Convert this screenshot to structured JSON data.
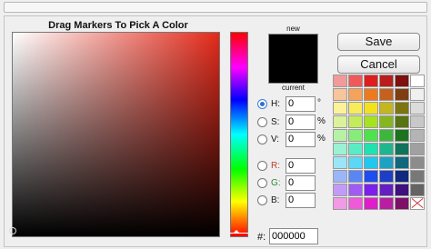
{
  "picker": {
    "title": "Drag Markers To Pick A Color",
    "new_label": "new",
    "current_label": "current",
    "new_color": "#000000",
    "current_color": "#000000"
  },
  "buttons": {
    "save": "Save",
    "cancel": "Cancel"
  },
  "fields": {
    "h": {
      "label": "H:",
      "value": "0",
      "unit": "°",
      "selected": true
    },
    "s": {
      "label": "S:",
      "value": "0",
      "unit": "%",
      "selected": false
    },
    "v": {
      "label": "V:",
      "value": "0",
      "unit": "%",
      "selected": false
    },
    "r": {
      "label": "R:",
      "value": "0",
      "selected": false,
      "color": "#c0392b"
    },
    "g": {
      "label": "G:",
      "value": "0",
      "selected": false,
      "color": "#2e8b2e"
    },
    "b": {
      "label": "B:",
      "value": "0",
      "selected": false,
      "color": "#1a1a1a"
    }
  },
  "hex": {
    "label": "#:",
    "value": "000000"
  },
  "palette": [
    "#f29a9a",
    "#ee5a5a",
    "#de1e1e",
    "#b81e1e",
    "#7e1010",
    "#ffffff",
    "#f8c49a",
    "#f5a25a",
    "#ee7a1e",
    "#c4611e",
    "#7e3e10",
    "#f0f0f0",
    "#fcf29a",
    "#f8ec5a",
    "#f2e21e",
    "#c4b61e",
    "#7e7410",
    "#dcdcdc",
    "#dcf29a",
    "#c4ec5a",
    "#a6e21e",
    "#86b61e",
    "#567410",
    "#c8c8c8",
    "#b6f2a6",
    "#86ec7a",
    "#4ee24e",
    "#3eb63e",
    "#1e741e",
    "#b4b4b4",
    "#9af2d2",
    "#5aecc4",
    "#1ee2b0",
    "#1eb68e",
    "#10745a",
    "#a0a0a0",
    "#9ae6f8",
    "#5ad8f5",
    "#1ec8ee",
    "#1ea2c4",
    "#10687e",
    "#8c8c8c",
    "#9ab6f8",
    "#5a86f5",
    "#1e4eee",
    "#1e3ec4",
    "#10287e",
    "#787878",
    "#c49af8",
    "#a25af5",
    "#7e1eee",
    "#641ec4",
    "#40107e",
    "#646464",
    "#f29ae6",
    "#ee5ad8",
    "#de1ec8",
    "#b81ea2",
    "#7e1068",
    "#ffffff"
  ],
  "no_color_label": "no-color"
}
